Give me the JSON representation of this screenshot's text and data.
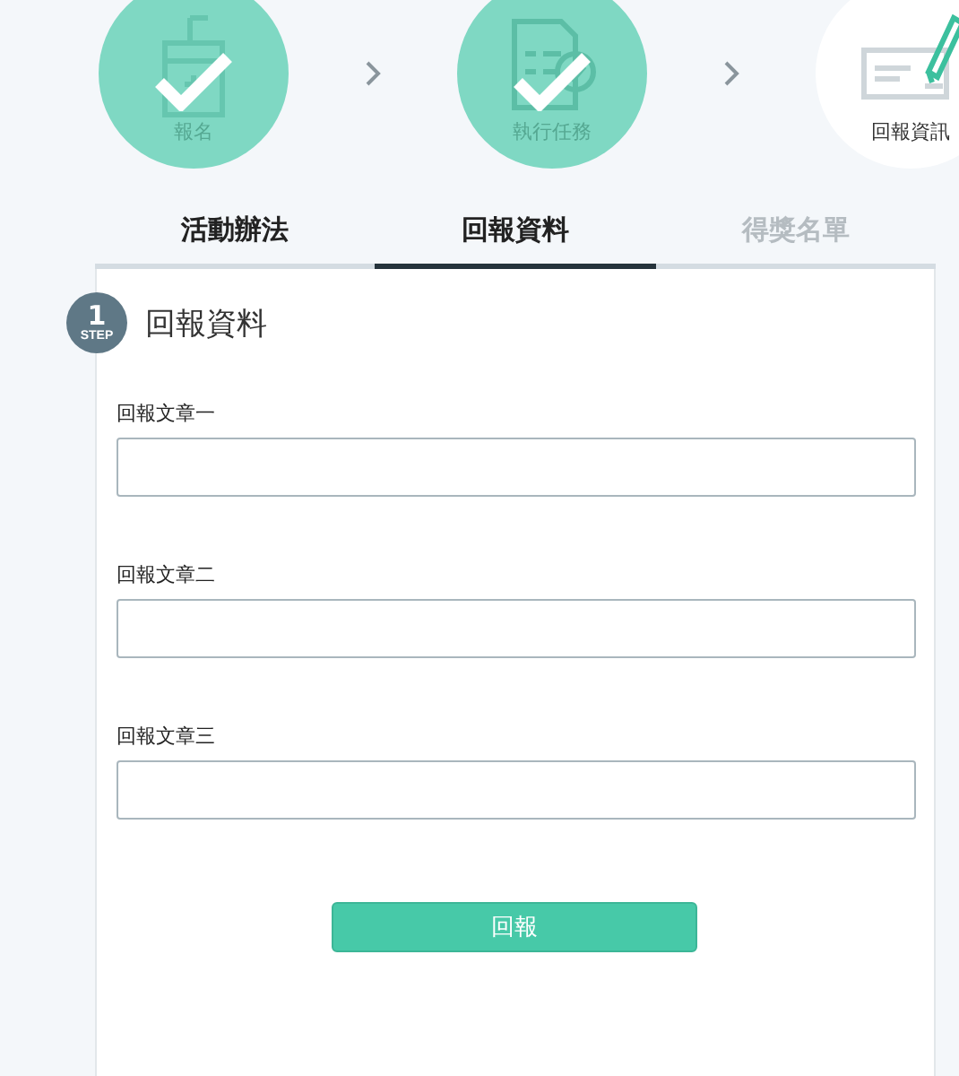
{
  "steps": [
    {
      "label": "報名",
      "done": true
    },
    {
      "label": "執行任務",
      "done": true
    },
    {
      "label": "回報資訊",
      "done": false
    }
  ],
  "tabs": [
    {
      "label": "活動辦法",
      "selected": false,
      "disabled": false
    },
    {
      "label": "回報資料",
      "selected": true,
      "disabled": false
    },
    {
      "label": "得獎名單",
      "selected": false,
      "disabled": true
    }
  ],
  "section": {
    "step_number": "1",
    "step_word": "STEP",
    "title": "回報資料"
  },
  "fields": [
    {
      "label": "回報文章一"
    },
    {
      "label": "回報文章二"
    },
    {
      "label": "回報文章三"
    }
  ],
  "submit_button": "回報"
}
